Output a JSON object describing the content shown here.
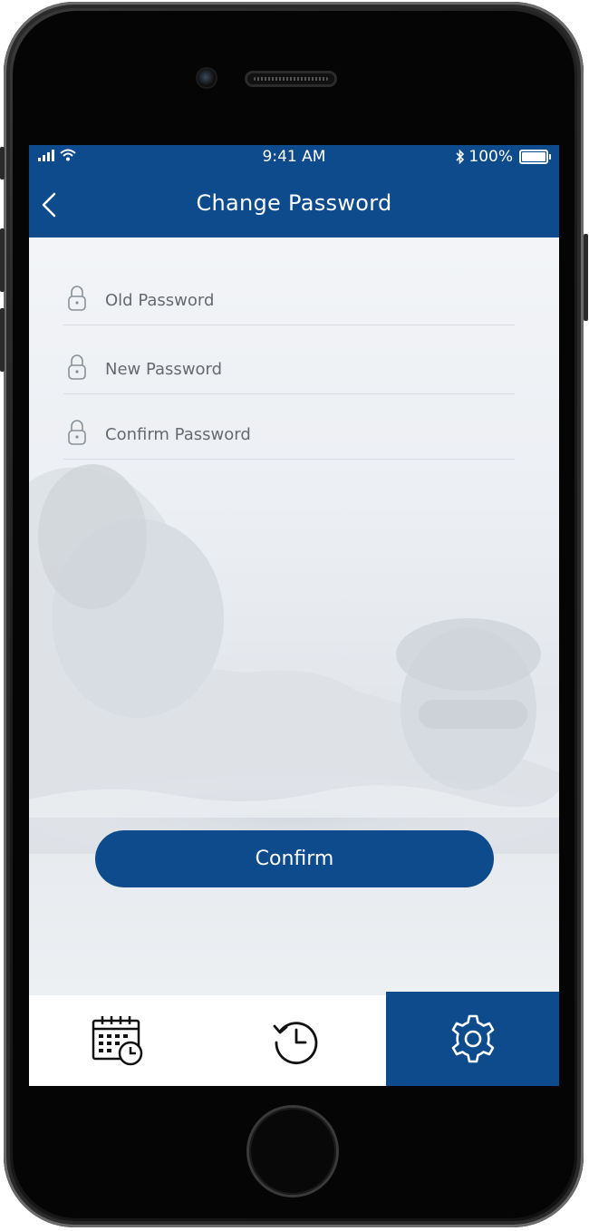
{
  "status_bar": {
    "time": "9:41 AM",
    "battery_percent": "100%",
    "icons": [
      "signal-bars-icon",
      "wifi-icon",
      "bluetooth-icon",
      "battery-icon"
    ]
  },
  "navbar": {
    "title": "Change Password",
    "back_icon": "chevron-left-icon"
  },
  "form": {
    "old_password": {
      "placeholder": "Old Password",
      "value": ""
    },
    "new_password": {
      "placeholder": "New Password",
      "value": ""
    },
    "confirm_password": {
      "placeholder": "Confirm Password",
      "value": ""
    },
    "field_icon": "lock-icon"
  },
  "confirm_button": {
    "label": "Confirm"
  },
  "tab_bar": {
    "tabs": [
      {
        "icon": "calendar-schedule-icon",
        "active": false
      },
      {
        "icon": "history-icon",
        "active": false
      },
      {
        "icon": "gear-icon",
        "active": true
      }
    ]
  },
  "colors": {
    "brand": "#0d4b8c",
    "background": "#eef1f5",
    "divider": "#d6dbe1",
    "text_muted": "#666a70"
  }
}
